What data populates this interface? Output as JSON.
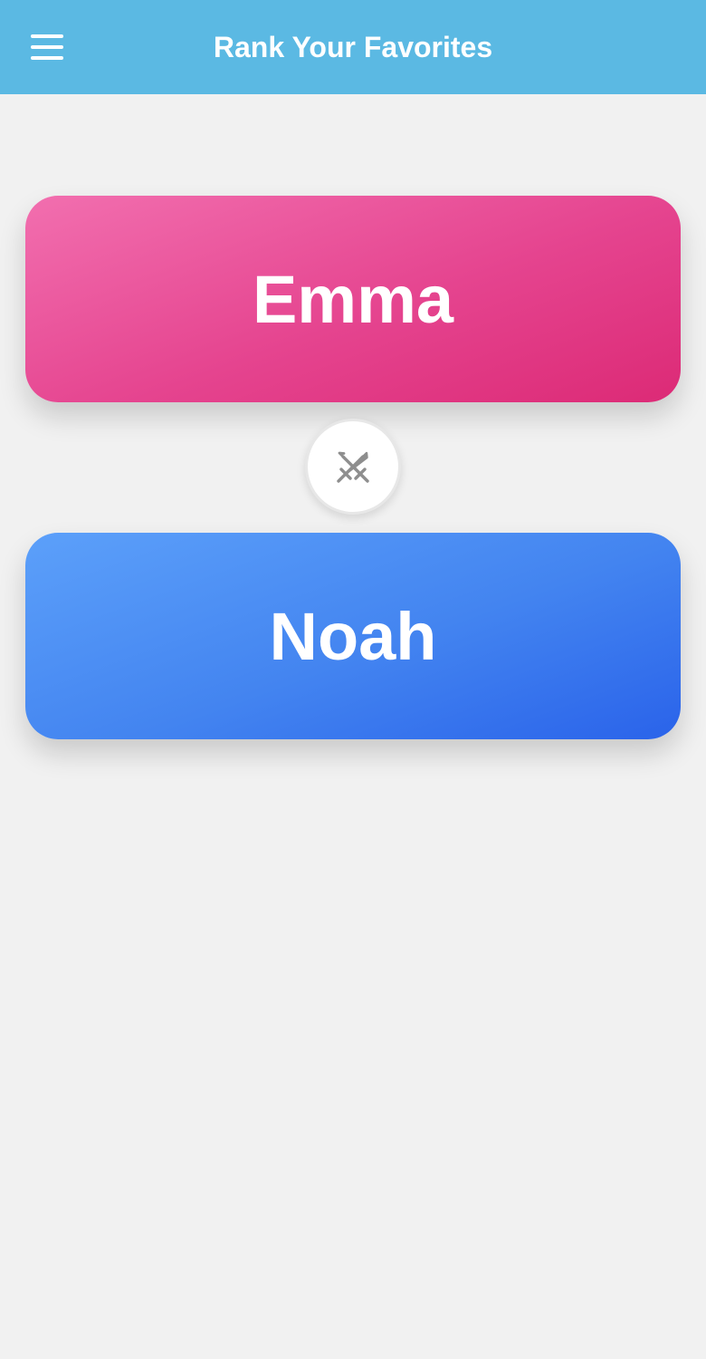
{
  "header": {
    "title": "Rank Your Favorites",
    "menu_icon": "hamburger-menu-icon",
    "background_color": "#5bb9e3"
  },
  "matchup": {
    "option_a": {
      "label": "Emma",
      "color": "#e5448f"
    },
    "option_b": {
      "label": "Noah",
      "color": "#4384f0"
    },
    "versus_icon": "crossed-swords-icon"
  }
}
